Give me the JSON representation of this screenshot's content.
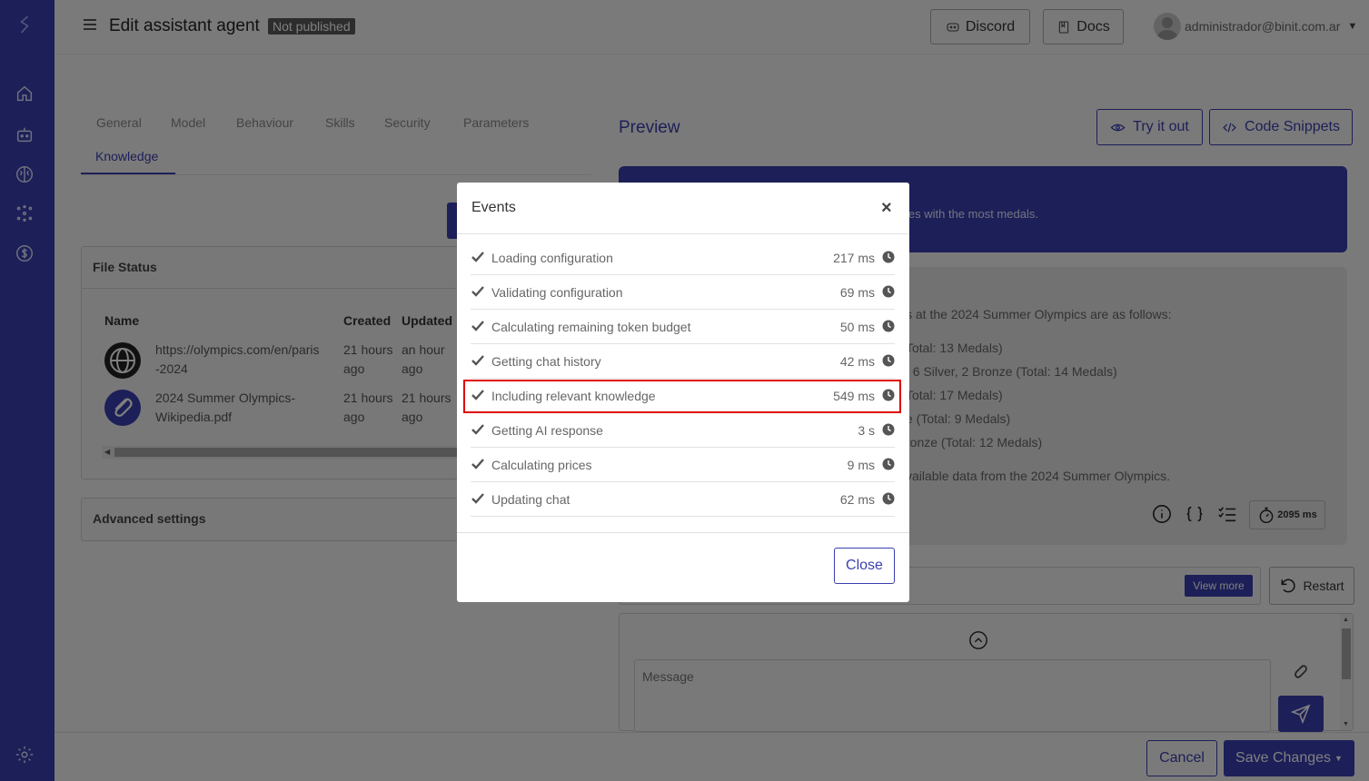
{
  "header": {
    "title": "Edit assistant agent",
    "badge": "Not published",
    "discord_label": "Discord",
    "docs_label": "Docs",
    "user_email": "administrador@binit.com.ar"
  },
  "tabs": [
    {
      "label": "General"
    },
    {
      "label": "Model"
    },
    {
      "label": "Behaviour"
    },
    {
      "label": "Skills"
    },
    {
      "label": "Security"
    },
    {
      "label": "Parameters"
    },
    {
      "label": "Knowledge"
    }
  ],
  "file_status": {
    "title": "File Status",
    "columns": [
      "Name",
      "Created",
      "Updated"
    ],
    "rows": [
      {
        "name_line1": "https://olympics.com/en/paris",
        "name_line2": "-2024",
        "created_line1": "21 hours",
        "created_line2": "ago",
        "updated_line1": "an hour",
        "updated_line2": "ago",
        "icon": "globe-icon"
      },
      {
        "name_line1": "2024 Summer Olympics-",
        "name_line2": "Wikipedia.pdf",
        "created_line1": "21 hours",
        "created_line2": "ago",
        "updated_line1": "21 hours",
        "updated_line2": "ago",
        "icon": "paperclip-icon"
      }
    ]
  },
  "advanced_settings": {
    "title": "Advanced settings"
  },
  "preview": {
    "title": "Preview",
    "try_label": "Try it out",
    "snippets_label": "Code Snippets",
    "user_msg_visible": "ies with the most medals.",
    "ai_lines": [
      "s at the 2024 Summer Olympics are as follows:",
      "Total: 13 Medals)",
      ", 6 Silver, 2 Bronze (Total: 14 Medals)",
      "Total: 17 Medals)",
      "e (Total: 9 Medals)",
      "ronze (Total: 12 Medals)",
      "vailable data from the 2024 Summer Olympics."
    ],
    "timer": "2095 ms",
    "view_more": "View more",
    "restart": "Restart",
    "message_placeholder": "Message"
  },
  "footer": {
    "cancel": "Cancel",
    "save": "Save Changes"
  },
  "modal": {
    "title": "Events",
    "close_label": "Close",
    "events": [
      {
        "label": "Loading configuration",
        "time": "217 ms"
      },
      {
        "label": "Validating configuration",
        "time": "69 ms"
      },
      {
        "label": "Calculating remaining token budget",
        "time": "50 ms"
      },
      {
        "label": "Getting chat history",
        "time": "42 ms"
      },
      {
        "label": "Including relevant knowledge",
        "time": "549 ms"
      },
      {
        "label": "Getting AI response",
        "time": "3 s"
      },
      {
        "label": "Calculating prices",
        "time": "9 ms"
      },
      {
        "label": "Updating chat",
        "time": "62 ms"
      }
    ],
    "highlighted_event_index": 4
  },
  "colors": {
    "brand": "#3a3fb0",
    "highlight": "#e00000"
  }
}
